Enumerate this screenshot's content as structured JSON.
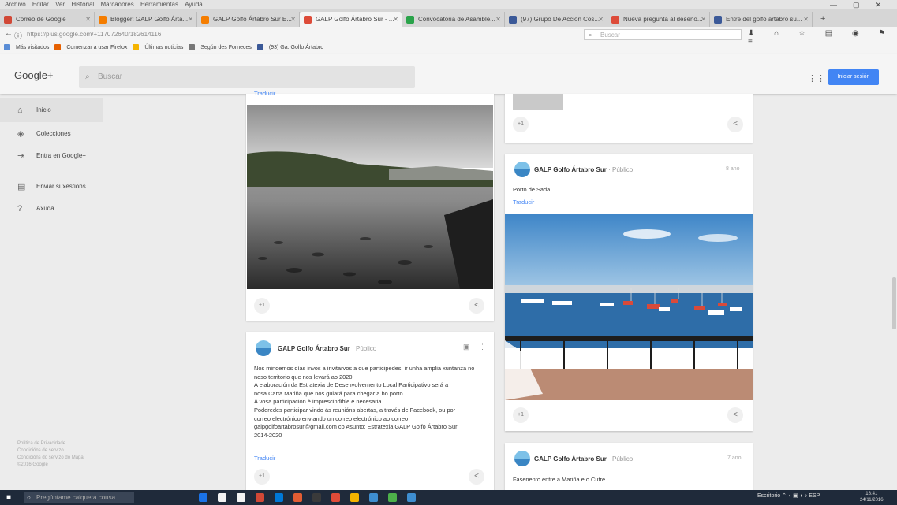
{
  "browser": {
    "menu": [
      "Archivo",
      "Editar",
      "Ver",
      "Historial",
      "Marcadores",
      "Herramientas",
      "Ayuda"
    ],
    "window_controls": [
      "—",
      "▢",
      "✕"
    ],
    "tabs": [
      {
        "label": "Correo de Google",
        "color": "#d14836"
      },
      {
        "label": "Blogger: GALP Golfo Árta...",
        "color": "#f57d00"
      },
      {
        "label": "GALP Golfo Ártabro Sur E...",
        "color": "#f57d00"
      },
      {
        "label": "GALP Golfo Ártabro Sur - ...",
        "color": "#dd4b39",
        "active": true
      },
      {
        "label": "Convocatoria de Asamble...",
        "color": "#2aa34a"
      },
      {
        "label": "(97) Grupo De Acción Cos...",
        "color": "#3b5998"
      },
      {
        "label": "Nueva pregunta al deseño...",
        "color": "#dd4b39"
      },
      {
        "label": "Entre del golfo ártabro su...",
        "color": "#3b5998"
      }
    ],
    "new_tab": "+",
    "url": "https://plus.google.com/+117072640/182614116",
    "search_placeholder": "Buscar",
    "nav_icons": "⬇ ⌂ ☆ ▤ ◉ ⚑ ≡",
    "bookmarks": [
      {
        "label": "Más visitados",
        "color": "#5a8dd6"
      },
      {
        "label": "Comenzar a usar Firefox",
        "color": "#e66000"
      },
      {
        "label": "Últimas noticias",
        "color": "#f5b400"
      },
      {
        "label": "Según des Forneces",
        "color": "#777777"
      },
      {
        "label": "(93) Ga. Golfo Ártabro",
        "color": "#3b5998"
      }
    ]
  },
  "gplus": {
    "logo": "Google+",
    "search_placeholder": "Buscar",
    "grid_icon": "⋮⋮",
    "cta_label": "Iniciar sesión",
    "sidebar": [
      {
        "icon": "home-icon",
        "glyph": "⌂",
        "label": "Inicio",
        "active": true
      },
      {
        "icon": "collections-icon",
        "glyph": "◈",
        "label": "Colecciones"
      },
      {
        "icon": "login-icon",
        "glyph": "⇥",
        "label": "Entra en Google+"
      },
      {
        "icon": "feedback-icon",
        "glyph": "▤",
        "label": "Enviar suxestións"
      },
      {
        "icon": "help-icon",
        "glyph": "?",
        "label": "Axuda"
      }
    ],
    "footer": [
      "Política de Privacidade",
      "Condicións de servizo",
      "Condicións do servizo do Mapa",
      "©2016 Google"
    ]
  },
  "posts": {
    "top_left_translate": "Traducir",
    "author": "GALP Golfo Ártabro Sur",
    "visibility": "Público",
    "plus_one": "+1",
    "share_glyph": "<",
    "post2_time": "8 ano",
    "post2_text": "Porto de Sada",
    "post2_translate": "Traducir",
    "post3_text": [
      "Nos mindemos días invos a invitarvos a que participedes, ir unha amplia xuntanza no",
      "noso territorio que nos levará ao 2020.",
      "A elaboración da Estratexia de Desenvolvemento Local Participativo será a",
      "nosa Carta Mariña que nos guiará para chegar a bo porto.",
      "A vosa participación é imprescindible e necesaria.",
      "Poderedes participar vindo ás reunións abertas, a través de Facebook, ou por",
      "correo electrónico enviando un correo electrónico ao correo",
      "galpgolfoartabrosur@gmail.com co Asunto: Estratexia GALP Golfo Ártabro Sur",
      "2014-2020"
    ],
    "post3_translate": "Traducir",
    "post3_more": "⋮",
    "post3_menu": "▣",
    "post4_time": "7 ano",
    "post4_text": "Fasenento entre a Mariña e o Cutre"
  },
  "taskbar": {
    "start": "■",
    "search_placeholder": "Pregúntame calquera cousa",
    "apps": [
      "#1a73e8",
      "#f2f2f2",
      "#f2f2f2",
      "#d14836",
      "#0078d7",
      "#e25d33",
      "#3a3a3a",
      "#e04b38",
      "#f5b400",
      "#3e8ed0",
      "#4db14a",
      "#3e8ed0"
    ],
    "tray": "Escritorio  ⌃  ◖ ▣ ◗ ♪  ESP",
    "time": "18:41",
    "date": "24/11/2016"
  }
}
